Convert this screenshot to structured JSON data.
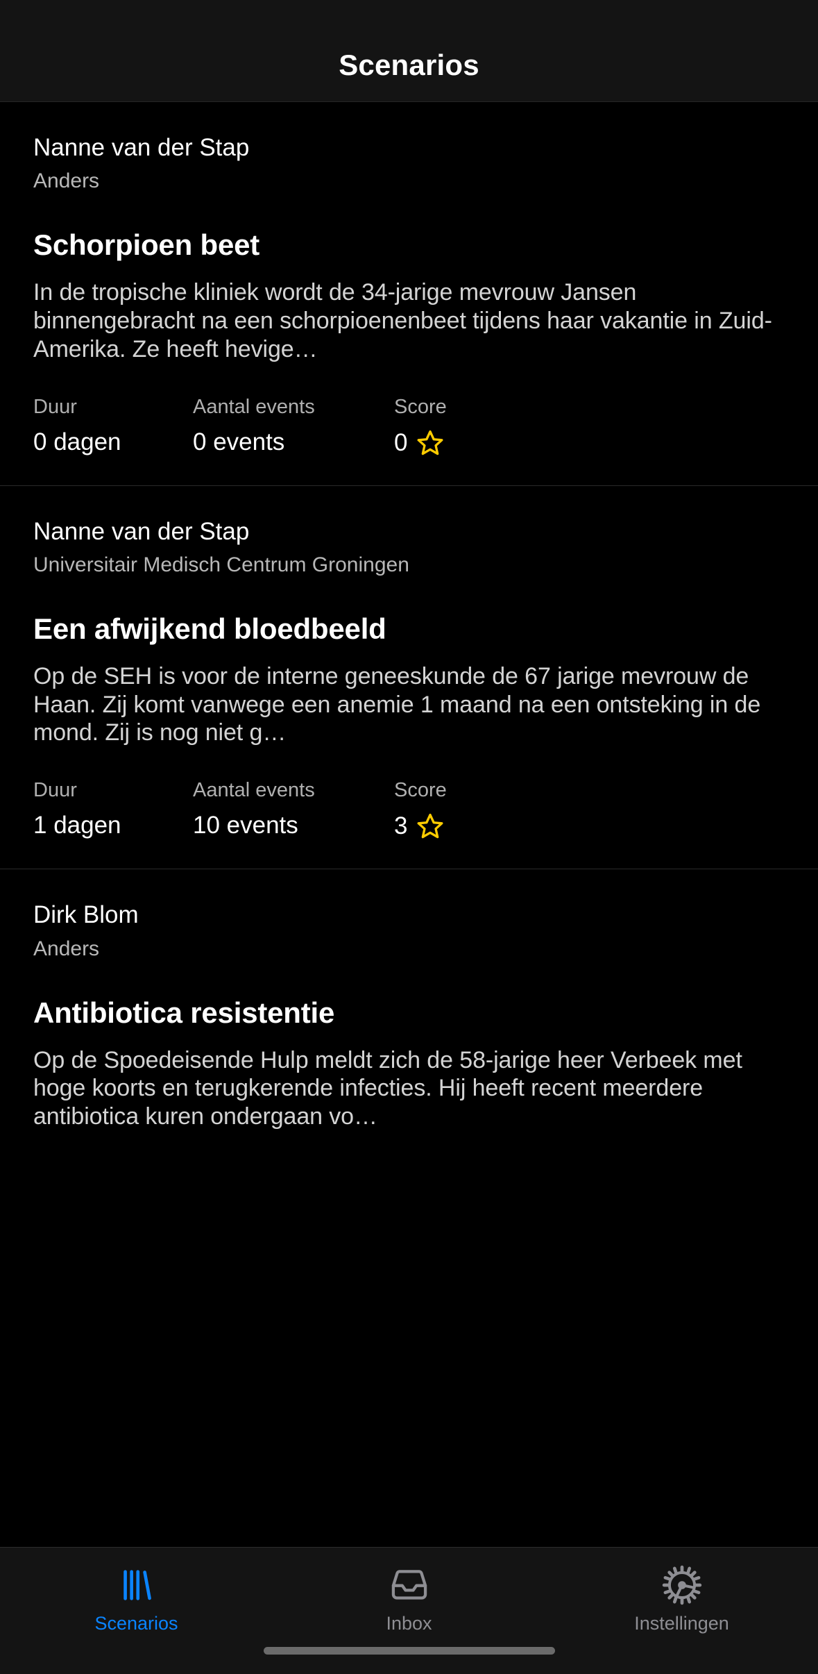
{
  "navbar": {
    "title": "Scenarios"
  },
  "colors": {
    "accent": "#0a84ff",
    "inactive": "#8e8e93",
    "star": "#ffcc00",
    "background": "#000000",
    "bar_background": "#141414"
  },
  "stat_labels": {
    "duur": "Duur",
    "events": "Aantal events",
    "score": "Score"
  },
  "scenarios": [
    {
      "author": "Nanne van der Stap",
      "org": "Anders",
      "title": "Schorpioen beet",
      "description": "In de tropische kliniek wordt de 34-jarige mevrouw Jansen binnengebracht na een schorpioenenbeet tijdens haar vakantie in Zuid-Amerika. Ze heeft hevige…",
      "duur": "0 dagen",
      "events": "0 events",
      "score": "0"
    },
    {
      "author": "Nanne van der Stap",
      "org": "Universitair Medisch Centrum Groningen",
      "title": "Een afwijkend bloedbeeld",
      "description": "Op de SEH is voor de interne geneeskunde de 67 jarige mevrouw de Haan. Zij komt vanwege een anemie 1 maand na een ontsteking in de mond. Zij is nog niet g…",
      "duur": "1 dagen",
      "events": "10 events",
      "score": "3"
    },
    {
      "author": "Dirk Blom",
      "org": "Anders",
      "title": "Antibiotica resistentie",
      "description": "Op de Spoedeisende Hulp meldt zich de 58-jarige heer Verbeek met hoge koorts en terugkerende infecties. Hij heeft recent meerdere antibiotica kuren ondergaan vo…"
    }
  ],
  "tabbar": {
    "items": [
      {
        "label": "Scenarios",
        "icon": "books-icon",
        "active": true
      },
      {
        "label": "Inbox",
        "icon": "inbox-icon",
        "active": false
      },
      {
        "label": "Instellingen",
        "icon": "gear-icon",
        "active": false
      }
    ]
  }
}
